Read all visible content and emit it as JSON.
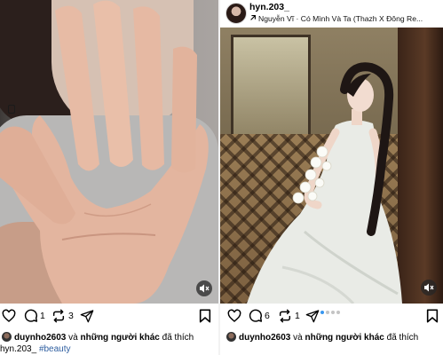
{
  "left_post": {
    "media_alt": "video",
    "actions": {
      "like_icon": "heart-icon",
      "comment_icon": "comment-icon",
      "comment_count": "1",
      "repost_icon": "repost-icon",
      "repost_count": "3",
      "share_icon": "send-icon",
      "save_icon": "bookmark-icon"
    },
    "likes": {
      "user": "duynho2603",
      "conj": "và",
      "others": "những người khác",
      "suffix": "đã thích"
    },
    "caption": {
      "username": "hyn.203_",
      "hashtag": "#beauty"
    }
  },
  "right_post": {
    "username": "hyn.203_",
    "music": "Nguyễn Vĩ · Có Mình Và Ta (Thazh X Đông Re...",
    "music_icon": "arrow-up-right-icon",
    "actions": {
      "like_icon": "heart-icon",
      "comment_icon": "comment-icon",
      "comment_count": "6",
      "repost_icon": "repost-icon",
      "repost_count": "1",
      "share_icon": "send-icon",
      "save_icon": "bookmark-icon"
    },
    "carousel": {
      "total": 4,
      "active": 1
    },
    "likes": {
      "user": "duynho2603",
      "conj": "và",
      "others": "những người khác",
      "suffix": "đã thích"
    }
  },
  "colors": {
    "accent": "#3897f0",
    "hashtag": "#2f5fa0",
    "dot_inactive": "#c4c4c4"
  }
}
